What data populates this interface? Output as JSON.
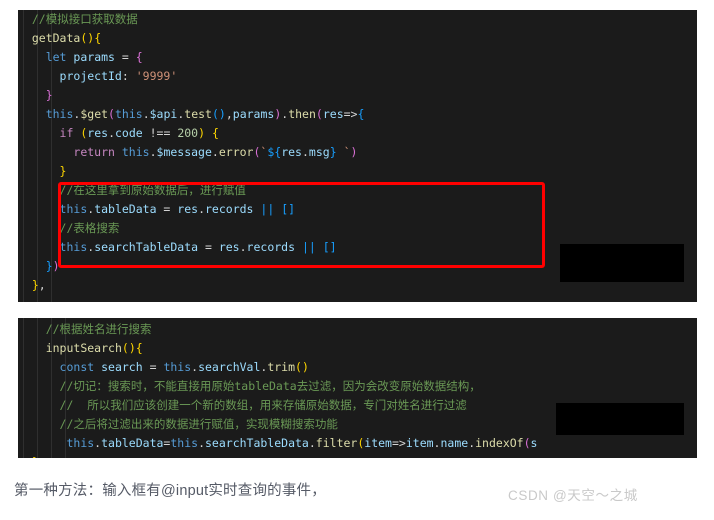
{
  "code_block_1": {
    "background": "#1b1b1b",
    "lines": [
      [
        {
          "text": "  //模拟接口获取数据",
          "cls": "t-com"
        }
      ],
      [
        {
          "text": "  ",
          "cls": "t-plain"
        },
        {
          "text": "getData",
          "cls": "t-fn"
        },
        {
          "text": "(",
          "cls": "t-p1"
        },
        {
          "text": ")",
          "cls": "t-p1"
        },
        {
          "text": "{",
          "cls": "t-p1"
        }
      ],
      [
        {
          "text": "    ",
          "cls": "t-plain"
        },
        {
          "text": "let",
          "cls": "t-kw"
        },
        {
          "text": " ",
          "cls": "t-plain"
        },
        {
          "text": "params",
          "cls": "t-var"
        },
        {
          "text": " = ",
          "cls": "t-op"
        },
        {
          "text": "{",
          "cls": "t-p2"
        }
      ],
      [
        {
          "text": "      ",
          "cls": "t-plain"
        },
        {
          "text": "projectId",
          "cls": "t-var"
        },
        {
          "text": ": ",
          "cls": "t-op"
        },
        {
          "text": "'9999'",
          "cls": "t-str"
        }
      ],
      [
        {
          "text": "    ",
          "cls": "t-plain"
        },
        {
          "text": "}",
          "cls": "t-p2"
        }
      ],
      [
        {
          "text": "    ",
          "cls": "t-plain"
        },
        {
          "text": "this",
          "cls": "t-this"
        },
        {
          "text": ".",
          "cls": "t-op"
        },
        {
          "text": "$get",
          "cls": "t-fn"
        },
        {
          "text": "(",
          "cls": "t-p2"
        },
        {
          "text": "this",
          "cls": "t-this"
        },
        {
          "text": ".",
          "cls": "t-op"
        },
        {
          "text": "$api",
          "cls": "t-var"
        },
        {
          "text": ".",
          "cls": "t-op"
        },
        {
          "text": "test",
          "cls": "t-fn"
        },
        {
          "text": "(",
          "cls": "t-p3"
        },
        {
          "text": ")",
          "cls": "t-p3"
        },
        {
          "text": ",",
          "cls": "t-op"
        },
        {
          "text": "params",
          "cls": "t-var"
        },
        {
          "text": ")",
          "cls": "t-p2"
        },
        {
          "text": ".",
          "cls": "t-op"
        },
        {
          "text": "then",
          "cls": "t-fn"
        },
        {
          "text": "(",
          "cls": "t-p2"
        },
        {
          "text": "res",
          "cls": "t-var"
        },
        {
          "text": "=>",
          "cls": "t-op"
        },
        {
          "text": "{",
          "cls": "t-p3"
        }
      ],
      [
        {
          "text": "      ",
          "cls": "t-plain"
        },
        {
          "text": "if",
          "cls": "t-kw2"
        },
        {
          "text": " ",
          "cls": "t-plain"
        },
        {
          "text": "(",
          "cls": "t-p1"
        },
        {
          "text": "res",
          "cls": "t-var"
        },
        {
          "text": ".",
          "cls": "t-op"
        },
        {
          "text": "code",
          "cls": "t-prop"
        },
        {
          "text": " !== ",
          "cls": "t-op"
        },
        {
          "text": "200",
          "cls": "t-num"
        },
        {
          "text": ")",
          "cls": "t-p1"
        },
        {
          "text": " ",
          "cls": "t-plain"
        },
        {
          "text": "{",
          "cls": "t-p1"
        }
      ],
      [
        {
          "text": "        ",
          "cls": "t-plain"
        },
        {
          "text": "return",
          "cls": "t-kw2"
        },
        {
          "text": " ",
          "cls": "t-plain"
        },
        {
          "text": "this",
          "cls": "t-this"
        },
        {
          "text": ".",
          "cls": "t-op"
        },
        {
          "text": "$message",
          "cls": "t-var"
        },
        {
          "text": ".",
          "cls": "t-op"
        },
        {
          "text": "error",
          "cls": "t-fn"
        },
        {
          "text": "(",
          "cls": "t-p2"
        },
        {
          "text": "`",
          "cls": "t-str"
        },
        {
          "text": "${",
          "cls": "t-p3"
        },
        {
          "text": "res",
          "cls": "t-var"
        },
        {
          "text": ".",
          "cls": "t-op"
        },
        {
          "text": "msg",
          "cls": "t-prop"
        },
        {
          "text": "}",
          "cls": "t-p3"
        },
        {
          "text": " `",
          "cls": "t-str"
        },
        {
          "text": ")",
          "cls": "t-p2"
        }
      ],
      [
        {
          "text": "      ",
          "cls": "t-plain"
        },
        {
          "text": "}",
          "cls": "t-p1"
        }
      ],
      [
        {
          "text": "      //在这里拿到原始数据后，进行赋值",
          "cls": "t-com"
        }
      ],
      [
        {
          "text": "      ",
          "cls": "t-plain"
        },
        {
          "text": "this",
          "cls": "t-this"
        },
        {
          "text": ".",
          "cls": "t-op"
        },
        {
          "text": "tableData",
          "cls": "t-prop"
        },
        {
          "text": " = ",
          "cls": "t-op"
        },
        {
          "text": "res",
          "cls": "t-var"
        },
        {
          "text": ".",
          "cls": "t-op"
        },
        {
          "text": "records",
          "cls": "t-prop"
        },
        {
          "text": " ",
          "cls": "t-plain"
        },
        {
          "text": "||",
          "cls": "t-p3"
        },
        {
          "text": " ",
          "cls": "t-plain"
        },
        {
          "text": "[]",
          "cls": "t-p3"
        }
      ],
      [
        {
          "text": "      //表格搜索",
          "cls": "t-com"
        }
      ],
      [
        {
          "text": "      ",
          "cls": "t-plain"
        },
        {
          "text": "this",
          "cls": "t-this"
        },
        {
          "text": ".",
          "cls": "t-op"
        },
        {
          "text": "searchTableData",
          "cls": "t-prop"
        },
        {
          "text": " = ",
          "cls": "t-op"
        },
        {
          "text": "res",
          "cls": "t-var"
        },
        {
          "text": ".",
          "cls": "t-op"
        },
        {
          "text": "records",
          "cls": "t-prop"
        },
        {
          "text": " ",
          "cls": "t-plain"
        },
        {
          "text": "||",
          "cls": "t-p3"
        },
        {
          "text": " ",
          "cls": "t-plain"
        },
        {
          "text": "[]",
          "cls": "t-p3"
        }
      ],
      [
        {
          "text": "    ",
          "cls": "t-plain"
        },
        {
          "text": "}",
          "cls": "t-p3"
        },
        {
          "text": ")",
          "cls": "t-p2"
        }
      ],
      [
        {
          "text": "  ",
          "cls": "t-plain"
        },
        {
          "text": "}",
          "cls": "t-p1"
        },
        {
          "text": ",",
          "cls": "t-op"
        }
      ]
    ]
  },
  "code_block_2": {
    "background": "#1b1b1b",
    "lines": [
      [
        {
          "text": "    //根据姓名进行搜索",
          "cls": "t-com"
        }
      ],
      [
        {
          "text": "    ",
          "cls": "t-plain"
        },
        {
          "text": "inputSearch",
          "cls": "t-fn"
        },
        {
          "text": "(",
          "cls": "t-p1"
        },
        {
          "text": ")",
          "cls": "t-p1"
        },
        {
          "text": "{",
          "cls": "t-p1"
        }
      ],
      [
        {
          "text": "      ",
          "cls": "t-plain"
        },
        {
          "text": "const",
          "cls": "t-kw"
        },
        {
          "text": " ",
          "cls": "t-plain"
        },
        {
          "text": "search",
          "cls": "t-var"
        },
        {
          "text": " = ",
          "cls": "t-op"
        },
        {
          "text": "this",
          "cls": "t-this"
        },
        {
          "text": ".",
          "cls": "t-op"
        },
        {
          "text": "searchVal",
          "cls": "t-prop"
        },
        {
          "text": ".",
          "cls": "t-op"
        },
        {
          "text": "trim",
          "cls": "t-fn"
        },
        {
          "text": "(",
          "cls": "t-p1"
        },
        {
          "text": ")",
          "cls": "t-p1"
        }
      ],
      [
        {
          "text": "      //切记：搜索时，不能直接用原始tableData去过滤，因为会改变原始数据结构，",
          "cls": "t-com"
        }
      ],
      [
        {
          "text": "      //  所以我们应该创建一个新的数组，用来存储原始数据，专门对姓名进行过滤",
          "cls": "t-com"
        }
      ],
      [
        {
          "text": "      //之后将过滤出来的数据进行赋值，实现模糊搜索功能",
          "cls": "t-com"
        }
      ],
      [
        {
          "text": "       ",
          "cls": "t-plain"
        },
        {
          "text": "this",
          "cls": "t-this"
        },
        {
          "text": ".",
          "cls": "t-op"
        },
        {
          "text": "tableData",
          "cls": "t-prop"
        },
        {
          "text": "=",
          "cls": "t-op"
        },
        {
          "text": "this",
          "cls": "t-this"
        },
        {
          "text": ".",
          "cls": "t-op"
        },
        {
          "text": "searchTableData",
          "cls": "t-prop"
        },
        {
          "text": ".",
          "cls": "t-op"
        },
        {
          "text": "filter",
          "cls": "t-fn"
        },
        {
          "text": "(",
          "cls": "t-p1"
        },
        {
          "text": "item",
          "cls": "t-var"
        },
        {
          "text": "=>",
          "cls": "t-op"
        },
        {
          "text": "item",
          "cls": "t-var"
        },
        {
          "text": ".",
          "cls": "t-op"
        },
        {
          "text": "name",
          "cls": "t-prop"
        },
        {
          "text": ".",
          "cls": "t-op"
        },
        {
          "text": "indexOf",
          "cls": "t-fn"
        },
        {
          "text": "(",
          "cls": "t-p2"
        },
        {
          "text": "s",
          "cls": "t-var"
        }
      ],
      [
        {
          "text": "  ",
          "cls": "t-plain"
        },
        {
          "text": "}",
          "cls": "t-p1"
        }
      ]
    ]
  },
  "annotations": {
    "red_box_color": "#ff0000",
    "redaction_color": "#000000",
    "redaction_1_label": "redacted-region",
    "redaction_2_label": "redacted-region"
  },
  "caption": {
    "text": "第一种方法：输入框有@input实时查询的事件，",
    "color": "#555a66"
  },
  "watermark": {
    "text": "CSDN @天空～之城",
    "color": "#c9c9c9"
  }
}
